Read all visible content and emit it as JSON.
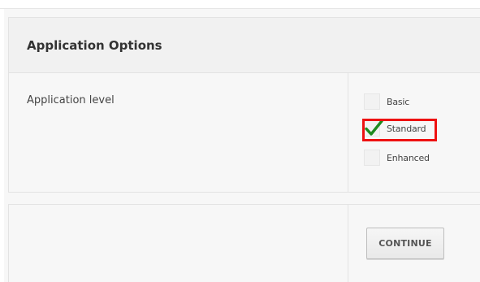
{
  "options_panel": {
    "title": "Application Options",
    "field_label": "Application level",
    "options": [
      {
        "label": "Basic",
        "checked": false
      },
      {
        "label": "Standard",
        "checked": true,
        "highlighted": true
      },
      {
        "label": "Enhanced",
        "checked": false
      }
    ]
  },
  "actions": {
    "continue_label": "CONTINUE"
  },
  "colors": {
    "checkmark": "#1f8a1f",
    "highlight_border": "#ee1111",
    "panel_background": "#f7f7f7",
    "header_background": "#f1f1f1"
  },
  "icons": {
    "checkmark": "checkmark-icon"
  }
}
